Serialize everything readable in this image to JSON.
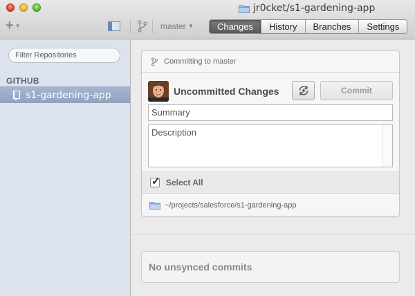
{
  "window": {
    "title": "jr0cket/s1-gardening-app"
  },
  "toolbar": {
    "add_icon": "plus-icon",
    "sidebar_toggle_icon": "sidebar-toggle-icon",
    "branch_icon": "branch-icon",
    "branch_name": "master",
    "tabs": [
      {
        "label": "Changes",
        "active": true
      },
      {
        "label": "History",
        "active": false
      },
      {
        "label": "Branches",
        "active": false
      },
      {
        "label": "Settings",
        "active": false
      }
    ]
  },
  "sidebar": {
    "filter_placeholder": "Filter Repositories",
    "section_title": "GITHUB",
    "repositories": [
      {
        "name": "s1-gardening-app",
        "selected": true
      }
    ]
  },
  "commit_panel": {
    "header": "Committing to master",
    "title": "Uncommitted Changes",
    "sync_icon": "sync-icon",
    "commit_label": "Commit",
    "summary_placeholder": "Summary",
    "description_placeholder": "Description",
    "select_all_label": "Select All",
    "select_all_checked": true,
    "repo_path": "~/projects/salesforce/s1-gardening-app"
  },
  "unsynced": {
    "message": "No unsynced commits"
  },
  "colors": {
    "selected_repo_bg": "#98a9c4",
    "sidebar_bg": "#dde3ec",
    "active_tab_bg": "#666666"
  }
}
